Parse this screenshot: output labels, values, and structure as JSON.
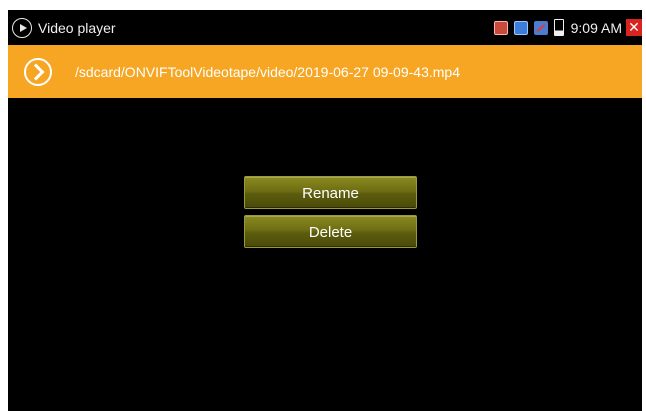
{
  "status_bar": {
    "app_title": "Video player",
    "time": "9:09 AM",
    "icons": [
      "play-circle-icon",
      "record-icon",
      "network-icon",
      "usb-icon",
      "battery-icon",
      "close-icon"
    ],
    "close_glyph": "✕"
  },
  "path_bar": {
    "file_path": "/sdcard/ONVIFToolVideotape/video/2019-06-27 09-09-43.mp4",
    "accent_color": "#f6a623"
  },
  "menu": {
    "rename_label": "Rename",
    "delete_label": "Delete"
  }
}
